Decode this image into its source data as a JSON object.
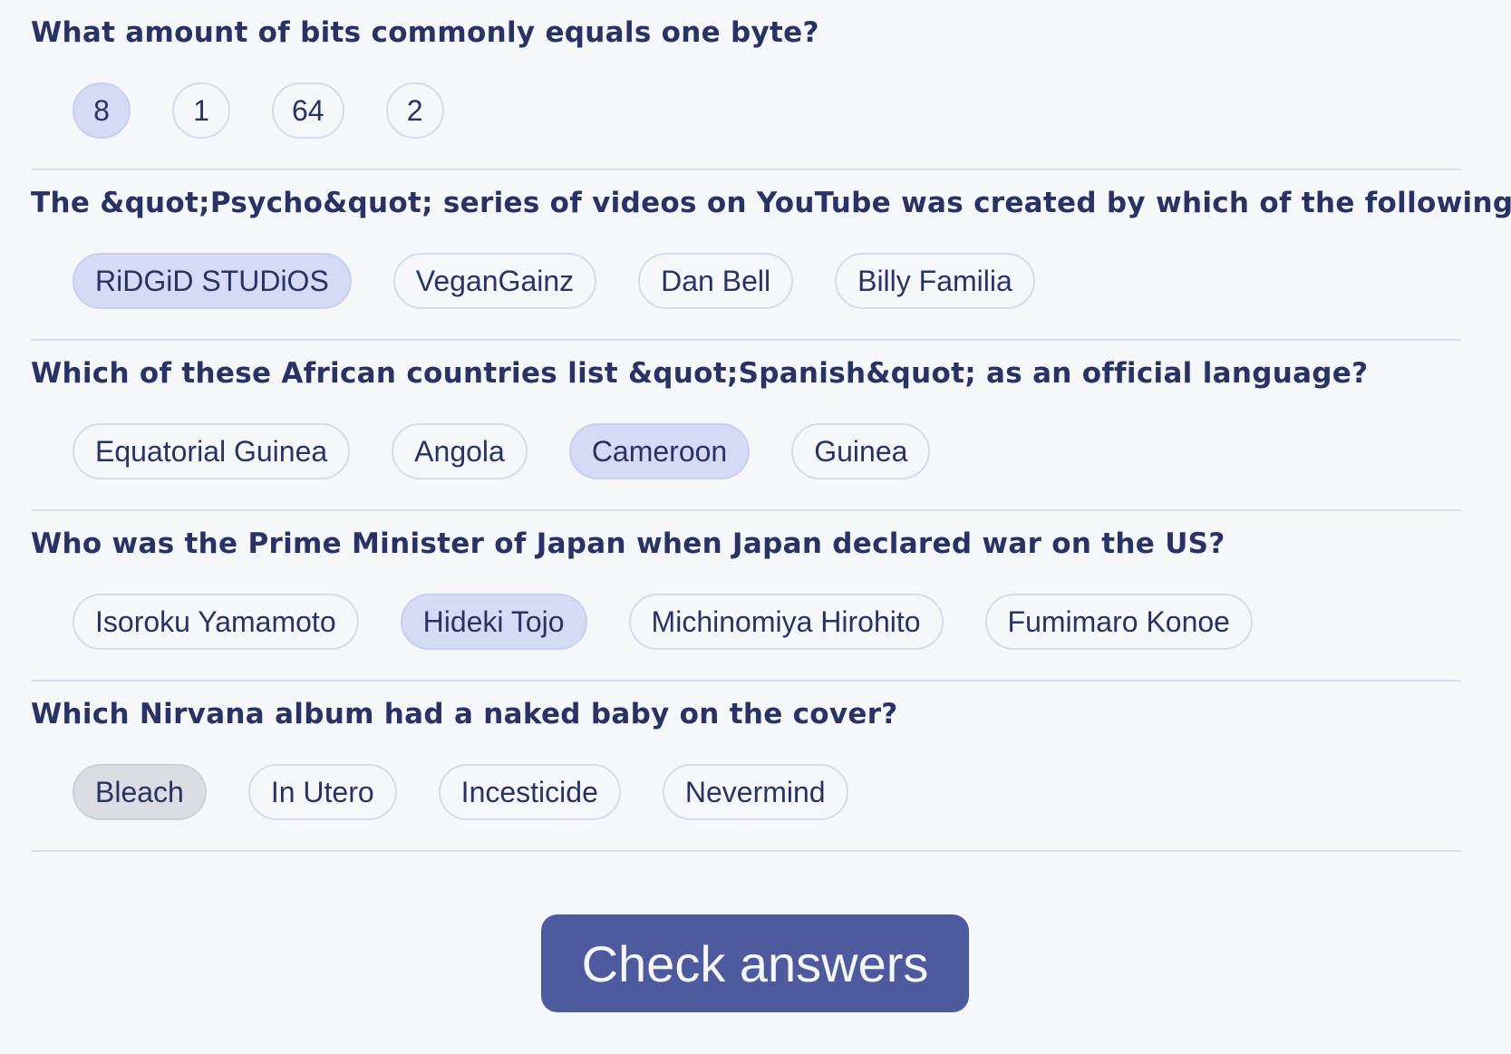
{
  "questions": [
    {
      "text": "What amount of bits commonly equals one byte?",
      "answers": [
        "8",
        "1",
        "64",
        "2"
      ]
    },
    {
      "text": "The &quot;Psycho&quot; series of videos on YouTube was created by which of the following?",
      "answers": [
        "RiDGiD STUDiOS",
        "VeganGainz",
        "Dan Bell",
        "Billy Familia"
      ]
    },
    {
      "text": "Which of these African countries list &quot;Spanish&quot; as an official language?",
      "answers": [
        "Equatorial Guinea",
        "Angola",
        "Cameroon",
        "Guinea"
      ]
    },
    {
      "text": "Who was the Prime Minister of Japan when Japan declared war on the US?",
      "answers": [
        "Isoroku Yamamoto",
        "Hideki Tojo",
        "Michinomiya Hirohito",
        "Fumimaro Konoe"
      ]
    },
    {
      "text": "Which Nirvana album had a naked baby on the cover?",
      "answers": [
        "Bleach",
        "In Utero",
        "Incesticide",
        "Nevermind"
      ]
    }
  ],
  "check_button_label": "Check answers",
  "colors": {
    "text": "#293264",
    "background": "#f5f7fb",
    "selected": "#d6dbf5",
    "selected_grey": "#dcdde3",
    "button": "#4d5b9e"
  }
}
